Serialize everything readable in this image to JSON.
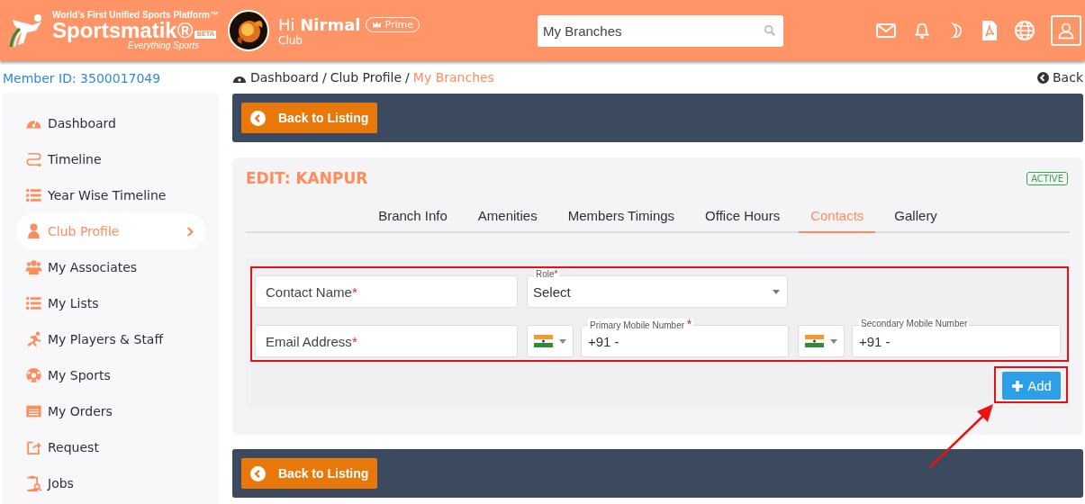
{
  "header": {
    "tagline": "World’s First Unified Sports Platform™",
    "brand": "Sportsmatik®",
    "beta": "BETA",
    "slogan": "Everything Sports",
    "greeting": "Hi",
    "user_name": "Nirmal",
    "badge": "Prime",
    "role": "Club",
    "search": {
      "value": "My Branches"
    }
  },
  "member_id": "Member ID: 3500017049",
  "sidebar": {
    "items": [
      {
        "label": "Dashboard",
        "selected": false
      },
      {
        "label": "Timeline",
        "selected": false
      },
      {
        "label": "Year Wise Timeline",
        "selected": false
      },
      {
        "label": "Club Profile",
        "selected": true
      },
      {
        "label": "My Associates",
        "selected": false
      },
      {
        "label": "My Lists",
        "selected": false
      },
      {
        "label": "My Players & Staff",
        "selected": false
      },
      {
        "label": "My Sports",
        "selected": false
      },
      {
        "label": "My Orders",
        "selected": false
      },
      {
        "label": "Request",
        "selected": false
      },
      {
        "label": "Jobs",
        "selected": false
      }
    ]
  },
  "breadcrumb": [
    {
      "label": "Dashboard",
      "kind": "link"
    },
    {
      "label": "/",
      "kind": "separator"
    },
    {
      "label": "Club Profile",
      "kind": "link"
    },
    {
      "label": "/",
      "kind": "separator"
    },
    {
      "label": "My Branches",
      "kind": "current"
    }
  ],
  "back": "Back",
  "top_bar": {
    "button": "Back to Listing"
  },
  "card": {
    "title": "EDIT: KANPUR",
    "status": "ACTIVE",
    "tabs": [
      {
        "label": "Branch Info",
        "selected": false
      },
      {
        "label": "Amenities",
        "selected": false
      },
      {
        "label": "Members Timings",
        "selected": false
      },
      {
        "label": "Office Hours",
        "selected": false
      },
      {
        "label": "Contacts",
        "selected": true
      },
      {
        "label": "Gallery",
        "selected": false
      }
    ],
    "form": {
      "contact_name": {
        "placeholder": "Contact Name",
        "mark": "*"
      },
      "role": {
        "label": "Role",
        "mark": "*",
        "value": "Select"
      },
      "email": {
        "placeholder": "Email Address",
        "mark": "*"
      },
      "primary_mobile": {
        "label": "Primary Mobile Number",
        "mark": "*",
        "value": "+91 -"
      },
      "secondary_mobile": {
        "label": "Secondary Mobile Number",
        "value": "+91 -"
      },
      "add_button": "Add"
    }
  },
  "bottom_bar": {
    "button": "Back to Listing"
  }
}
